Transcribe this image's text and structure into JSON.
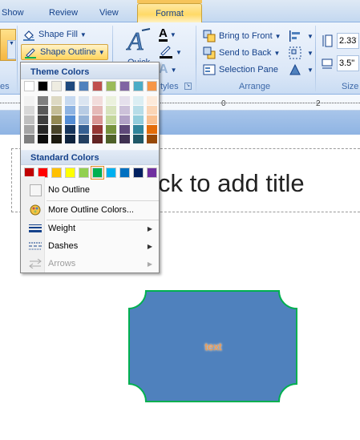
{
  "tabs": [
    {
      "label": "Show"
    },
    {
      "label": "Review"
    },
    {
      "label": "View"
    },
    {
      "label": "Format"
    }
  ],
  "ribbon": {
    "shape_fill": "Shape Fill",
    "shape_outline": "Shape Outline",
    "quick_styles": "Quick",
    "wordart_group": "tyles",
    "left_group": "es",
    "bring_to_front": "Bring to Front",
    "send_to_back": "Send to Back",
    "selection_pane": "Selection Pane",
    "arrange_group": "Arrange",
    "height_value": "2.33\"",
    "width_value": "3.5\"",
    "size_group": "Size"
  },
  "ruler": {
    "label_zero": "0",
    "label_two": "2"
  },
  "slide": {
    "title_placeholder": "ck to add title",
    "shape_text": "text"
  },
  "menu": {
    "theme_colors": "Theme Colors",
    "standard_colors": "Standard Colors",
    "no_outline": "No Outline",
    "more_colors": "More Outline Colors...",
    "weight": "Weight",
    "dashes": "Dashes",
    "arrows": "Arrows",
    "theme_row": [
      "#ffffff",
      "#000000",
      "#eeece1",
      "#1f497d",
      "#4f81bd",
      "#c0504d",
      "#9bbb59",
      "#8064a2",
      "#4bacc6",
      "#f79646"
    ],
    "theme_shades": [
      [
        "#f2f2f2",
        "#d8d8d8",
        "#bfbfbf",
        "#a5a5a5",
        "#7f7f7f"
      ],
      [
        "#7f7f7f",
        "#595959",
        "#3f3f3f",
        "#262626",
        "#0c0c0c"
      ],
      [
        "#ddd9c3",
        "#c4bd97",
        "#938953",
        "#494429",
        "#1d1b10"
      ],
      [
        "#c6d9f0",
        "#8db3e2",
        "#548dd4",
        "#17365d",
        "#0f243e"
      ],
      [
        "#dbe5f1",
        "#b8cce4",
        "#95b3d7",
        "#366092",
        "#244061"
      ],
      [
        "#f2dcdb",
        "#e5b9b7",
        "#d99694",
        "#953734",
        "#632423"
      ],
      [
        "#ebf1dd",
        "#d7e3bc",
        "#c3d69b",
        "#76923c",
        "#4f6128"
      ],
      [
        "#e5e0ec",
        "#ccc1d9",
        "#b2a2c7",
        "#5f497a",
        "#3f3151"
      ],
      [
        "#dbeef3",
        "#b7dde8",
        "#92cddc",
        "#31859b",
        "#205867"
      ],
      [
        "#fdeada",
        "#fbd5b5",
        "#fac08f",
        "#e36c09",
        "#974806"
      ]
    ],
    "standard_row": [
      "#c00000",
      "#ff0000",
      "#ffc000",
      "#ffff00",
      "#92d050",
      "#00b050",
      "#00b0f0",
      "#0070c0",
      "#002060",
      "#7030a0"
    ],
    "selected_standard_index": 5
  },
  "colors": {
    "shape_fill": "#4f81bd",
    "shape_outline": "#00b050",
    "shape_text": "#f79646"
  },
  "icons": [
    "shape-fill-icon",
    "shape-outline-icon",
    "quick-styles-icon",
    "text-fill-icon",
    "text-outline-icon",
    "text-effects-icon",
    "bring-to-front-icon",
    "send-to-back-icon",
    "selection-pane-icon",
    "align-icon",
    "group-icon",
    "rotate-icon",
    "height-icon",
    "width-icon",
    "no-outline-icon",
    "more-colors-icon",
    "weight-icon",
    "dashes-icon",
    "arrows-icon"
  ]
}
